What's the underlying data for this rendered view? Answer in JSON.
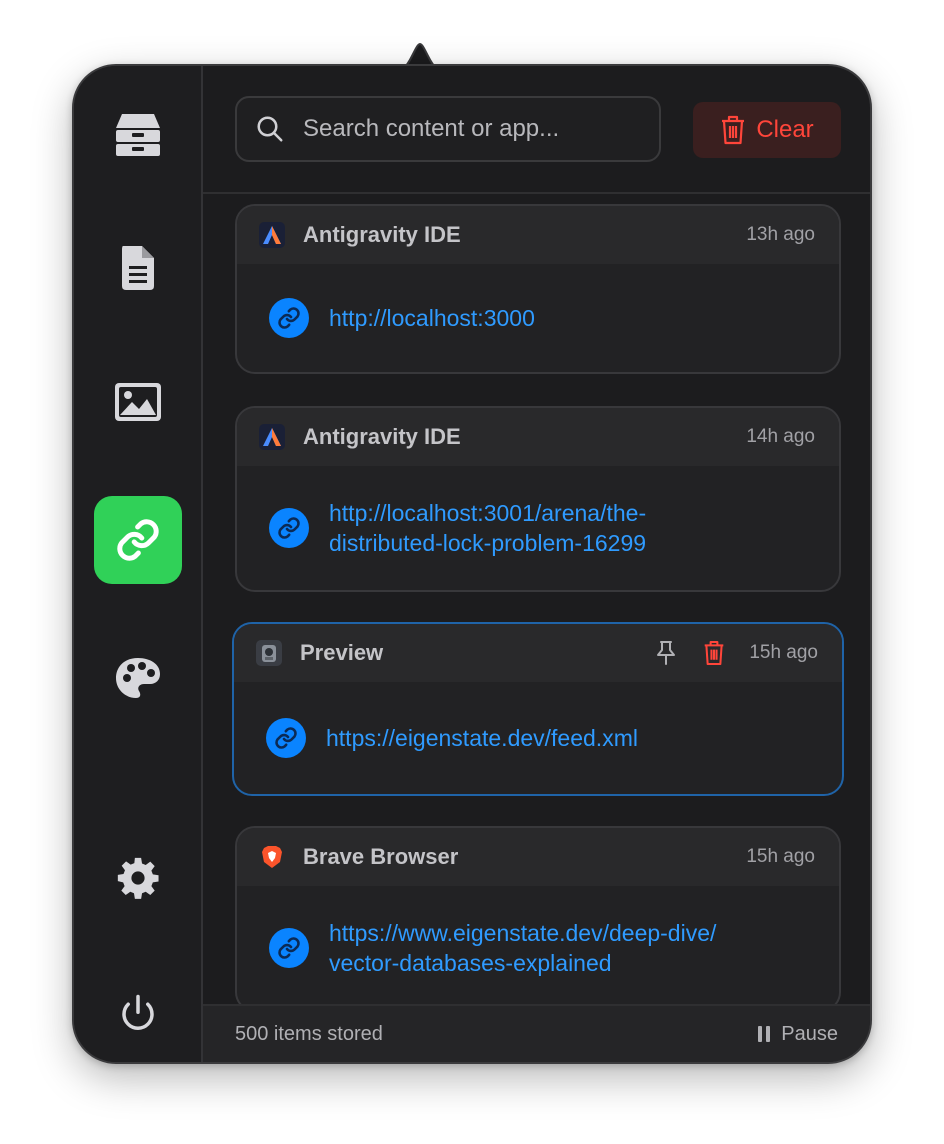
{
  "search": {
    "placeholder": "Search content or app..."
  },
  "clear_label": "Clear",
  "sidebar": {
    "items": [
      {
        "name": "all-items",
        "icon": "tray-icon",
        "active": false
      },
      {
        "name": "text",
        "icon": "document-icon",
        "active": false
      },
      {
        "name": "images",
        "icon": "image-icon",
        "active": false
      },
      {
        "name": "links",
        "icon": "link-icon",
        "active": true
      },
      {
        "name": "colors",
        "icon": "palette-icon",
        "active": false
      },
      {
        "name": "settings",
        "icon": "gear-icon",
        "active": false
      },
      {
        "name": "quit",
        "icon": "power-icon",
        "active": false
      }
    ]
  },
  "items": [
    {
      "app": "Antigravity IDE",
      "time": "13h ago",
      "lines": [
        "http://localhost:3000"
      ]
    },
    {
      "app": "Antigravity IDE",
      "time": "14h ago",
      "lines": [
        "http://localhost:3001/arena/the-",
        "distributed-lock-problem-16299"
      ]
    },
    {
      "app": "Preview",
      "time": "15h ago",
      "lines": [
        "https://eigenstate.dev/feed.xml"
      ]
    },
    {
      "app": "Brave Browser",
      "time": "15h ago",
      "lines": [
        "https://www.eigenstate.dev/deep-dive/",
        "vector-databases-explained"
      ]
    }
  ],
  "footer": {
    "count": "500 items stored",
    "pause_label": "Pause"
  },
  "colors": {
    "accent_green": "#30d158",
    "link_blue": "#0a84ff",
    "danger_red": "#ff453a",
    "panel_bg": "#1c1c1e"
  }
}
